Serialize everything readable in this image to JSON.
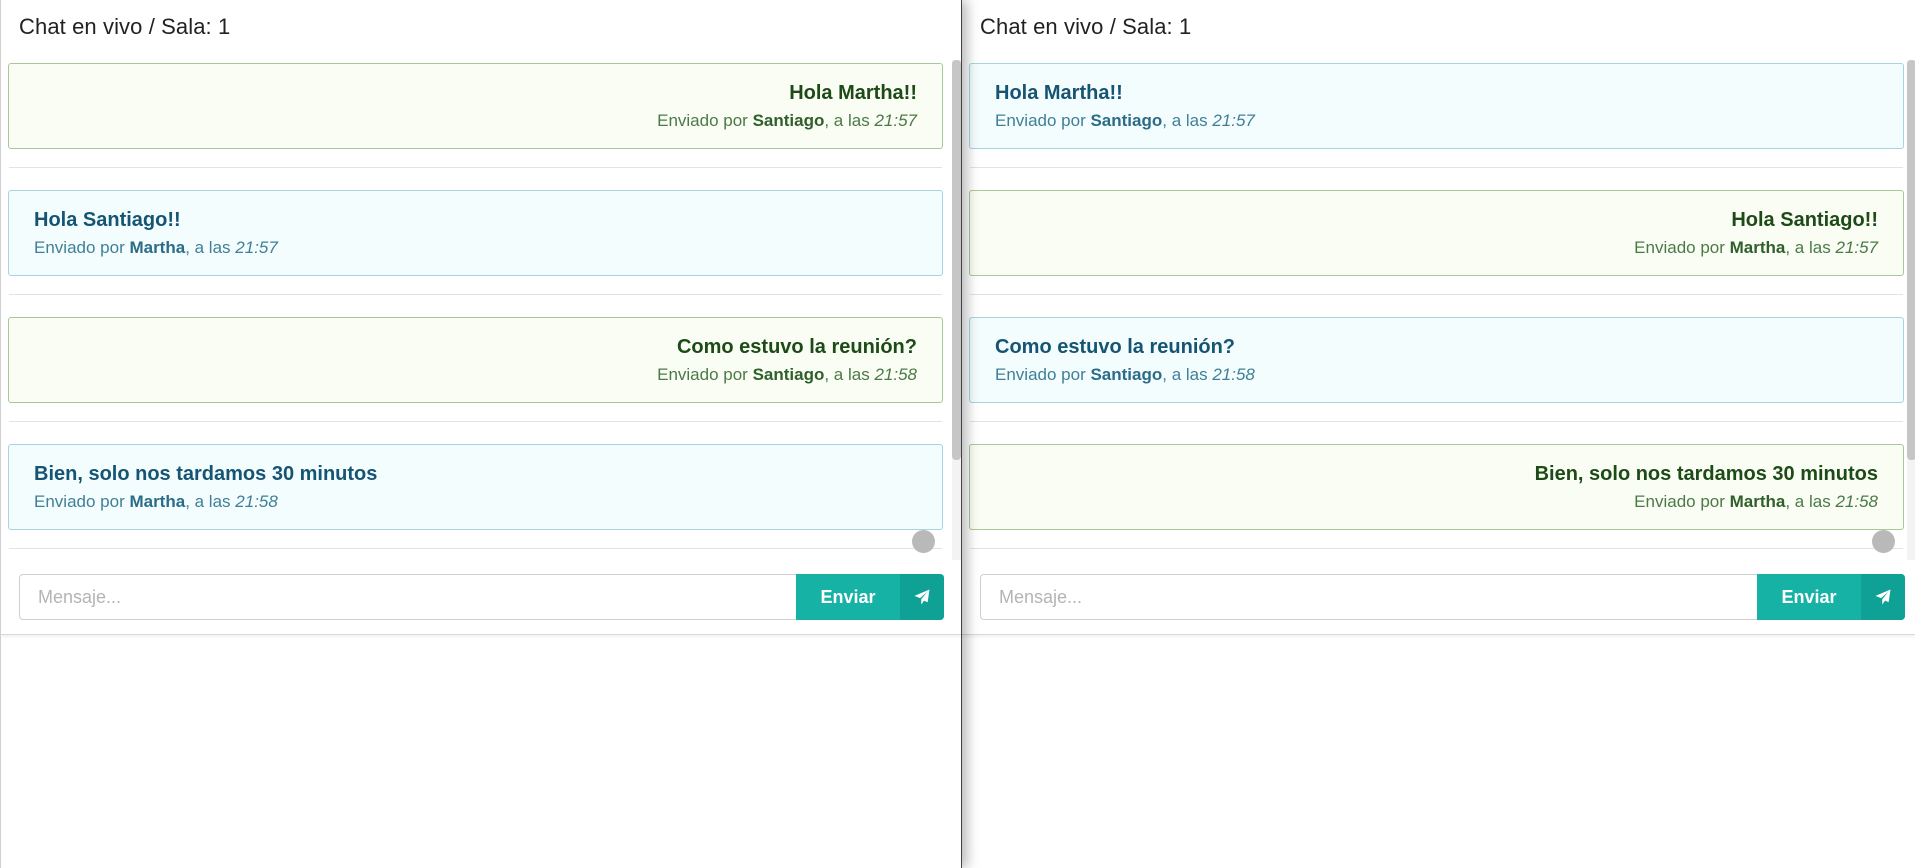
{
  "windows": [
    {
      "title": "Chat en vivo / Sala: 1",
      "messages": [
        {
          "text": "Hola Martha!!",
          "sent_prefix": "Enviado por ",
          "sender": "Santiago",
          "time_prefix": ", a las ",
          "time": "21:57",
          "own": true
        },
        {
          "text": "Hola Santiago!!",
          "sent_prefix": "Enviado por ",
          "sender": "Martha",
          "time_prefix": ", a las ",
          "time": "21:57",
          "own": false
        },
        {
          "text": "Como estuvo la reunión?",
          "sent_prefix": "Enviado por ",
          "sender": "Santiago",
          "time_prefix": ", a las ",
          "time": "21:58",
          "own": true
        },
        {
          "text": "Bien, solo nos tardamos 30 minutos",
          "sent_prefix": "Enviado por ",
          "sender": "Martha",
          "time_prefix": ", a las ",
          "time": "21:58",
          "own": false
        }
      ],
      "input_placeholder": "Mensaje...",
      "input_value": "",
      "send_label": "Enviar"
    },
    {
      "title": "Chat en vivo / Sala: 1",
      "messages": [
        {
          "text": "Hola Martha!!",
          "sent_prefix": "Enviado por ",
          "sender": "Santiago",
          "time_prefix": ", a las ",
          "time": "21:57",
          "own": false
        },
        {
          "text": "Hola Santiago!!",
          "sent_prefix": "Enviado por ",
          "sender": "Martha",
          "time_prefix": ", a las ",
          "time": "21:57",
          "own": true
        },
        {
          "text": "Como estuvo la reunión?",
          "sent_prefix": "Enviado por ",
          "sender": "Santiago",
          "time_prefix": ", a las ",
          "time": "21:58",
          "own": false
        },
        {
          "text": "Bien, solo nos tardamos 30 minutos",
          "sent_prefix": "Enviado por ",
          "sender": "Martha",
          "time_prefix": ", a las ",
          "time": "21:58",
          "own": true
        }
      ],
      "input_placeholder": "Mensaje...",
      "input_value": "",
      "send_label": "Enviar"
    }
  ],
  "icons": {
    "send": "paper-plane-icon",
    "scroll_indicator": "circle-dot-icon"
  },
  "colors": {
    "accent": "#16b2a5",
    "accent_dark": "#0fa195",
    "own_bg": "#fafdf4",
    "own_border": "#a9c89a",
    "own_text": "#1d4b17",
    "other_bg": "#f4fdfe",
    "other_border": "#a7d3e2",
    "other_text": "#165473"
  }
}
